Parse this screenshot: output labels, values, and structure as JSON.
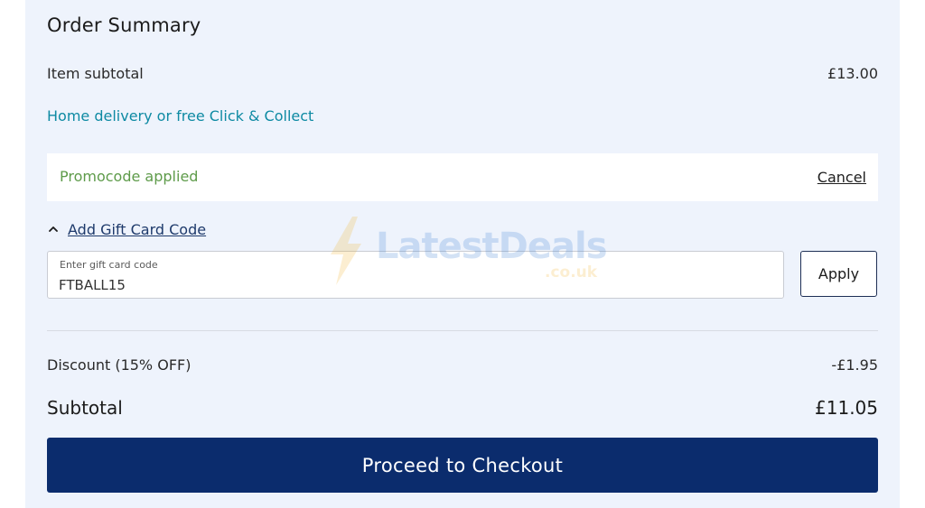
{
  "order_summary": {
    "title": "Order Summary",
    "item_subtotal_label": "Item subtotal",
    "item_subtotal_value": "£13.00",
    "delivery_link": "Home delivery or free Click & Collect"
  },
  "promo": {
    "status": "Promocode applied",
    "cancel_label": "Cancel"
  },
  "gift_card": {
    "toggle_label": "Add Gift Card Code",
    "input_label": "Enter gift card code",
    "input_value": "FTBALL15",
    "apply_label": "Apply"
  },
  "totals": {
    "discount_label": "Discount (15% OFF)",
    "discount_value": "-£1.95",
    "subtotal_label": "Subtotal",
    "subtotal_value": "£11.05"
  },
  "checkout": {
    "label": "Proceed to Checkout"
  },
  "watermark": {
    "brand": "LatestDeals",
    "domain": ".co.uk"
  },
  "colors": {
    "panel_bg": "#eef3fc",
    "teal_link": "#0e8aa3",
    "promo_green": "#5e9b4a",
    "checkout_bg": "#0b2c6d"
  },
  "icons": {
    "gift_toggle": "chevron-up-icon",
    "watermark": "lightning-bolt-icon"
  }
}
